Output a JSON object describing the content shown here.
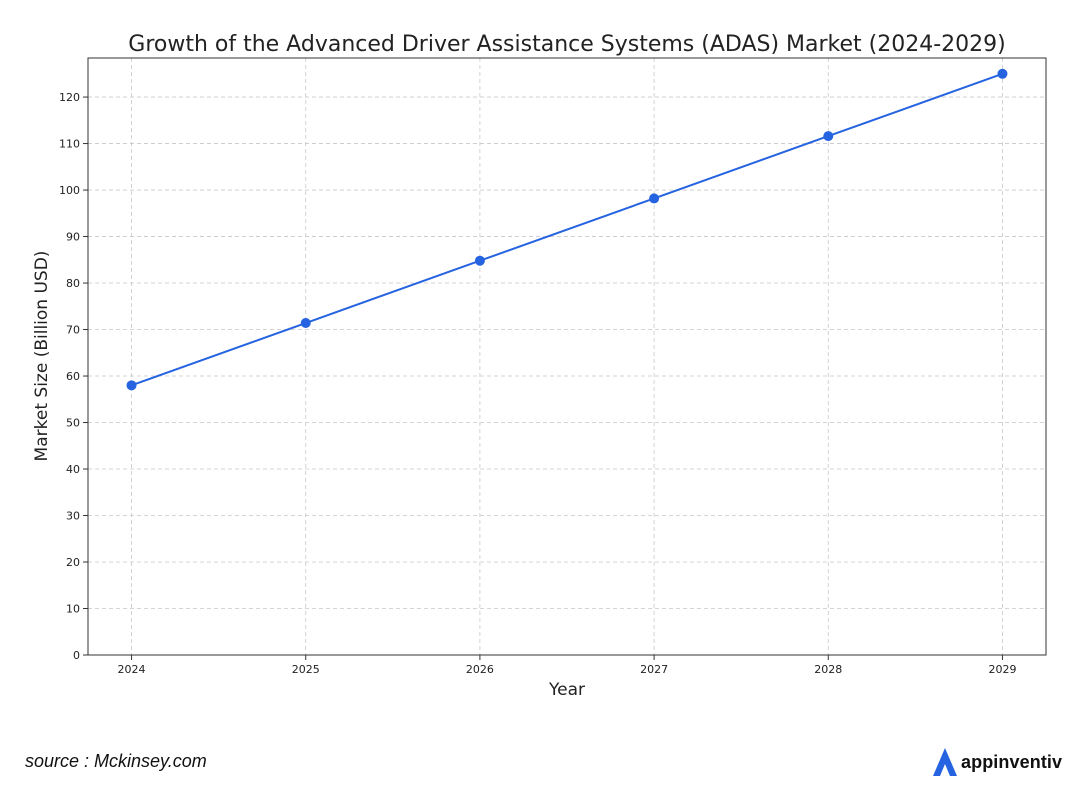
{
  "chart_data": {
    "type": "line",
    "title": "Growth of the Advanced Driver Assistance Systems (ADAS) Market (2024-2029)",
    "xlabel": "Year",
    "ylabel": "Market Size (Billion USD)",
    "x": [
      2024,
      2025,
      2026,
      2027,
      2028,
      2029
    ],
    "x_tick_labels": [
      "2024",
      "2025",
      "2026",
      "2027",
      "2028",
      "2029"
    ],
    "series": [
      {
        "values": [
          58.0,
          71.4,
          84.8,
          98.2,
          111.6,
          125.0
        ],
        "color": "#2563e0",
        "marker": "circle"
      }
    ],
    "y_ticks": [
      0,
      10,
      20,
      30,
      40,
      50,
      60,
      70,
      80,
      90,
      100,
      110,
      120
    ],
    "ylim": [
      0,
      128.4
    ],
    "xlim": [
      2023.75,
      2029.25
    ],
    "grid": true,
    "grid_style": "dashed"
  },
  "footer": {
    "source_text": "source : Mckinsey.com",
    "brand_name": "appinventiv",
    "brand_icon": "appinventiv-logo-icon",
    "brand_color": "#2563e0"
  }
}
